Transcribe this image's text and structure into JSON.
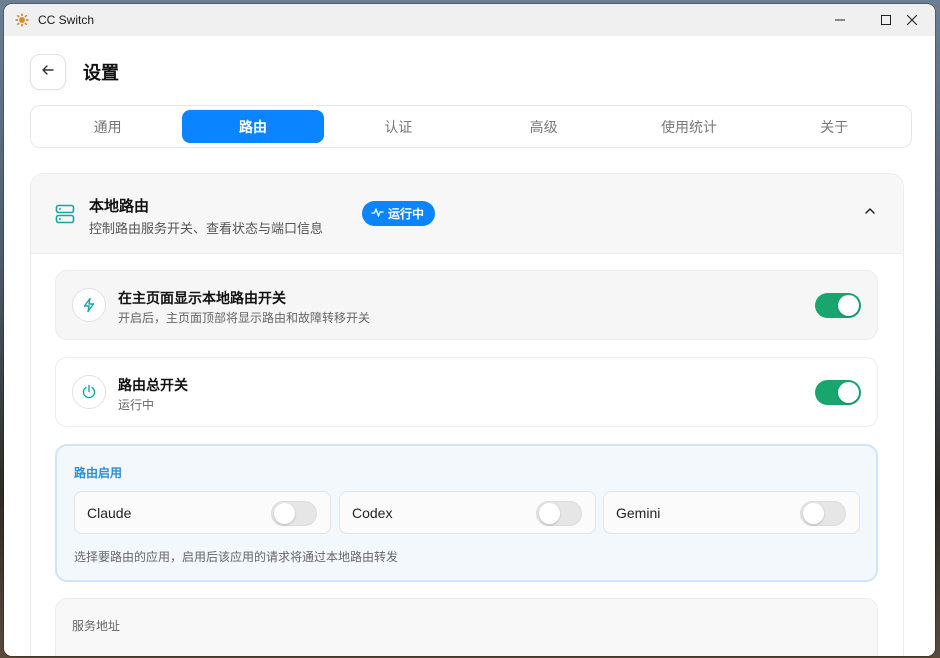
{
  "window": {
    "title": "CC Switch",
    "app_icon": "sun-logo-icon"
  },
  "controls": {
    "minimize": "minimize-icon",
    "maximize": "maximize-icon",
    "close": "close-icon"
  },
  "header": {
    "title": "设置",
    "back_icon": "arrow-left-icon"
  },
  "tabs": [
    {
      "label": "通用",
      "active": false
    },
    {
      "label": "路由",
      "active": true
    },
    {
      "label": "认证",
      "active": false
    },
    {
      "label": "高级",
      "active": false
    },
    {
      "label": "使用统计",
      "active": false
    },
    {
      "label": "关于",
      "active": false
    }
  ],
  "section": {
    "icon": "server-icon",
    "title": "本地路由",
    "subtitle": "控制路由服务开关、查看状态与端口信息",
    "status_badge": "运行中",
    "status_icon": "activity-icon",
    "collapse_icon": "chevron-up-icon"
  },
  "settings": [
    {
      "icon": "bolt-icon",
      "title": "在主页面显示本地路由开关",
      "description": "开启后，主页面顶部将显示路由和故障转移开关",
      "enabled": true
    },
    {
      "icon": "power-icon",
      "title": "路由总开关",
      "description": "运行中",
      "enabled": true
    }
  ],
  "routing_enable": {
    "label": "路由启用",
    "apps": [
      {
        "name": "Claude",
        "enabled": false
      },
      {
        "name": "Codex",
        "enabled": false
      },
      {
        "name": "Gemini",
        "enabled": false
      }
    ],
    "hint": "选择要路由的应用，启用后该应用的请求将通过本地路由转发"
  },
  "service": {
    "label": "服务地址"
  },
  "colors": {
    "accent": "#0a84ff",
    "toggle_on": "#18a66e",
    "route_box_border": "#cfe4f8",
    "route_label": "#2a8ed8"
  }
}
